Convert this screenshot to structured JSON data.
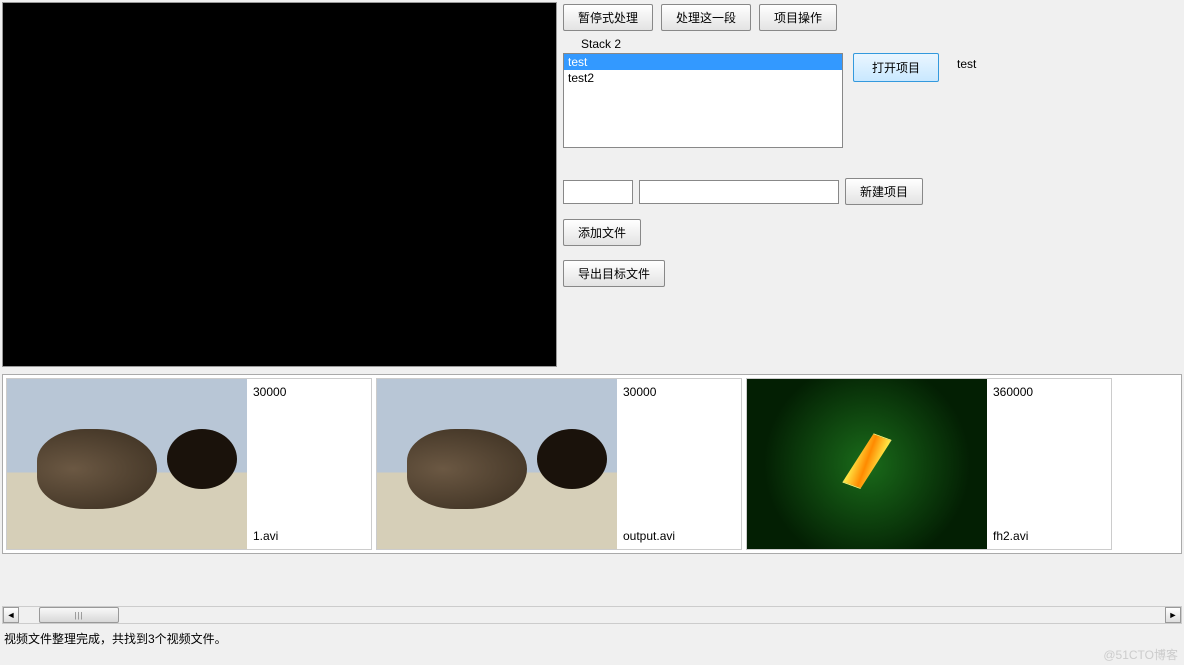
{
  "toolbar": {
    "pause_label": "暂停式处理",
    "process_segment_label": "处理这一段",
    "project_ops_label": "项目操作"
  },
  "stack": {
    "label": "Stack 2",
    "items": [
      "test",
      "test2"
    ],
    "selected_index": 0
  },
  "open_project": {
    "button_label": "打开项目",
    "project_name": "test"
  },
  "new_project": {
    "input1_value": "",
    "input2_value": "",
    "button_label": "新建项目"
  },
  "add_file_label": "添加文件",
  "export_target_label": "导出目标文件",
  "thumbnails": [
    {
      "duration": "30000",
      "filename": "1.avi",
      "kind": "sea-lion"
    },
    {
      "duration": "30000",
      "filename": "output.avi",
      "kind": "sea-lion"
    },
    {
      "duration": "360000",
      "filename": "fh2.avi",
      "kind": "green-screen"
    }
  ],
  "status_text": "视频文件整理完成，共找到3个视频文件。",
  "watermark": "@51CTO博客"
}
